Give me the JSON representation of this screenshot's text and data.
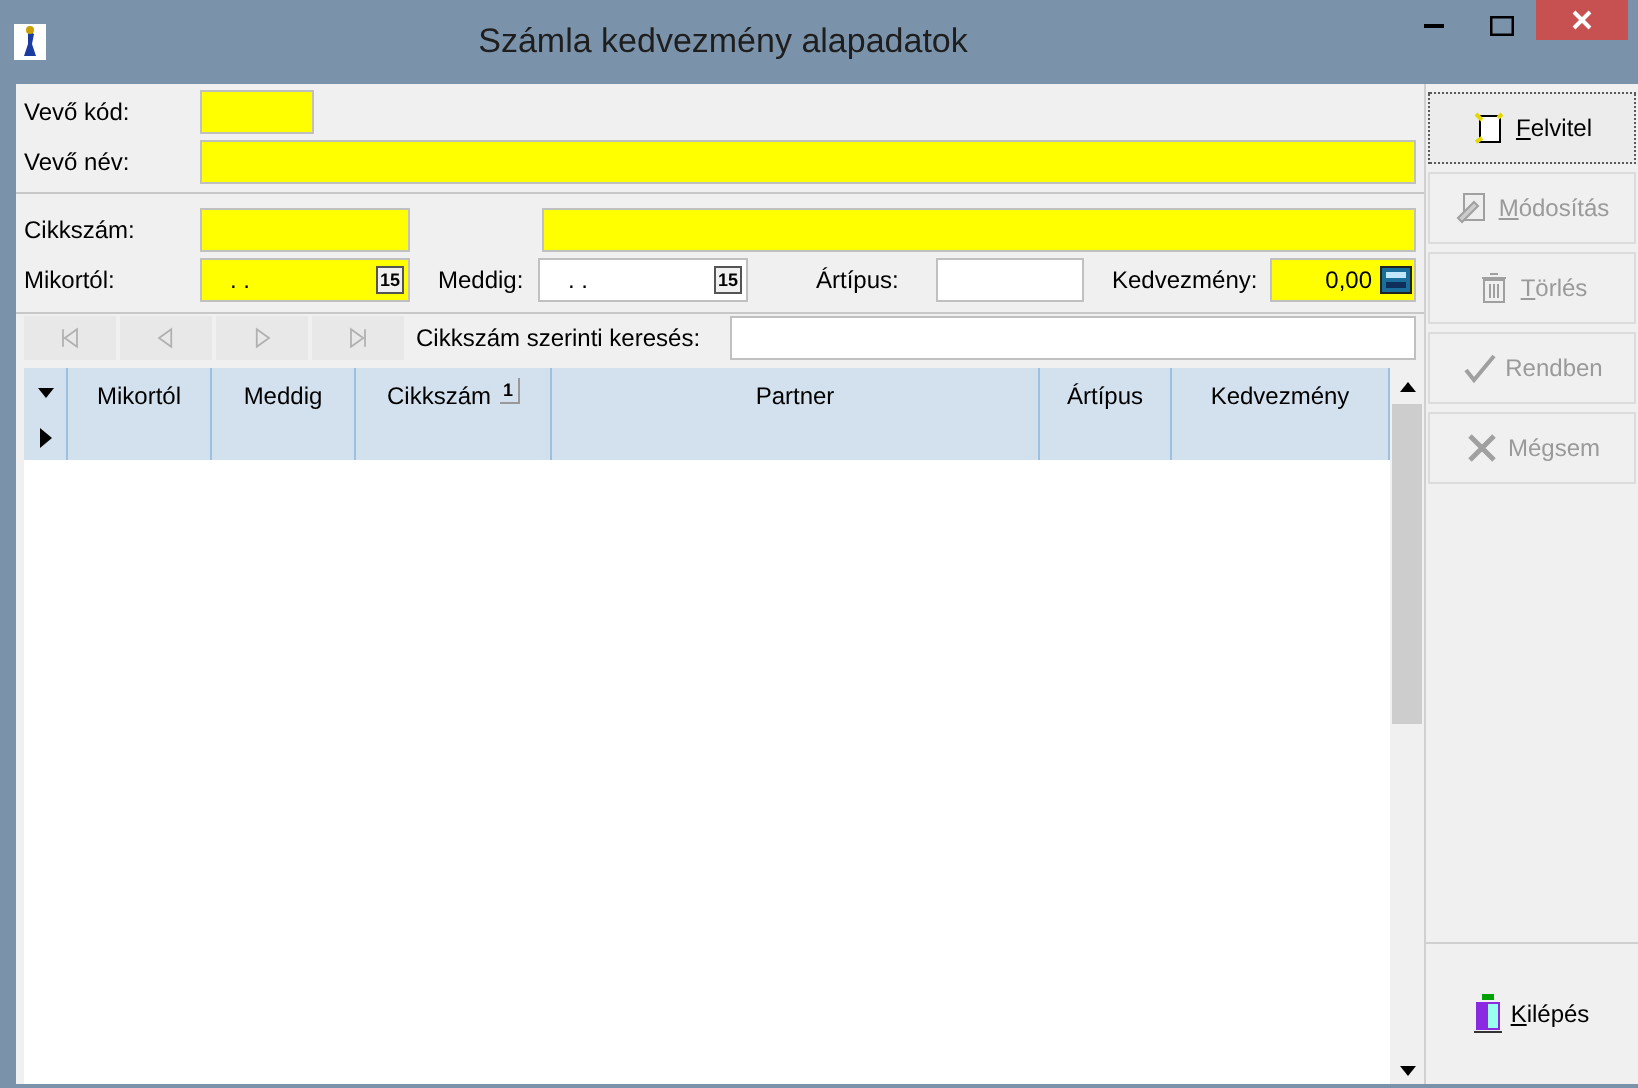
{
  "window": {
    "title": "Számla kedvezmény alapadatok"
  },
  "customer": {
    "code_label": "Vevő kód:",
    "code_value_highlighted": true,
    "name_label": "Vevő név:"
  },
  "item": {
    "label": "Cikkszám:"
  },
  "filters": {
    "from_label": "Mikortól:",
    "from_value": ". .",
    "from_highlighted": true,
    "from_calendar_day": "15",
    "to_calendar_day": "15",
    "to_label": "Meddig:",
    "to_value": ". .",
    "to_highlighted": false,
    "price_type_label": "Ártípus:",
    "discount_label": "Kedvezmény:",
    "discount_value": "0,00"
  },
  "navigator": {
    "buttons": [
      {
        "kind": "first",
        "disabled": true
      },
      {
        "kind": "prev",
        "disabled": true
      },
      {
        "kind": "next",
        "disabled": true
      },
      {
        "kind": "last",
        "disabled": true
      }
    ],
    "search_label": "Cikkszám szerinti keresés:"
  },
  "table": {
    "columns": [
      {
        "label": "Mikortól"
      },
      {
        "label": "Meddig"
      },
      {
        "label": "Cikkszám",
        "sort": "1"
      },
      {
        "label": "Partner"
      },
      {
        "label": "Ártípus"
      },
      {
        "label": "Kedvezmény"
      }
    ],
    "rows": [
      {
        "current": true
      }
    ]
  },
  "actions": [
    {
      "label": "Felvitel",
      "kind": "add",
      "disabled": false,
      "mnemonic": true,
      "focused": true
    },
    {
      "label": "Módosítás",
      "kind": "edit",
      "disabled": true,
      "mnemonic": true,
      "focused": false
    },
    {
      "label": "Törlés",
      "kind": "delete",
      "disabled": true,
      "mnemonic": true,
      "focused": false
    },
    {
      "label": "Rendben",
      "kind": "ok",
      "disabled": true,
      "mnemonic": false,
      "focused": false
    },
    {
      "label": "Mégsem",
      "kind": "cancel",
      "disabled": true,
      "mnemonic": false,
      "focused": false
    }
  ],
  "exit_button": {
    "label": "Kilépés",
    "mnemonic": true
  }
}
